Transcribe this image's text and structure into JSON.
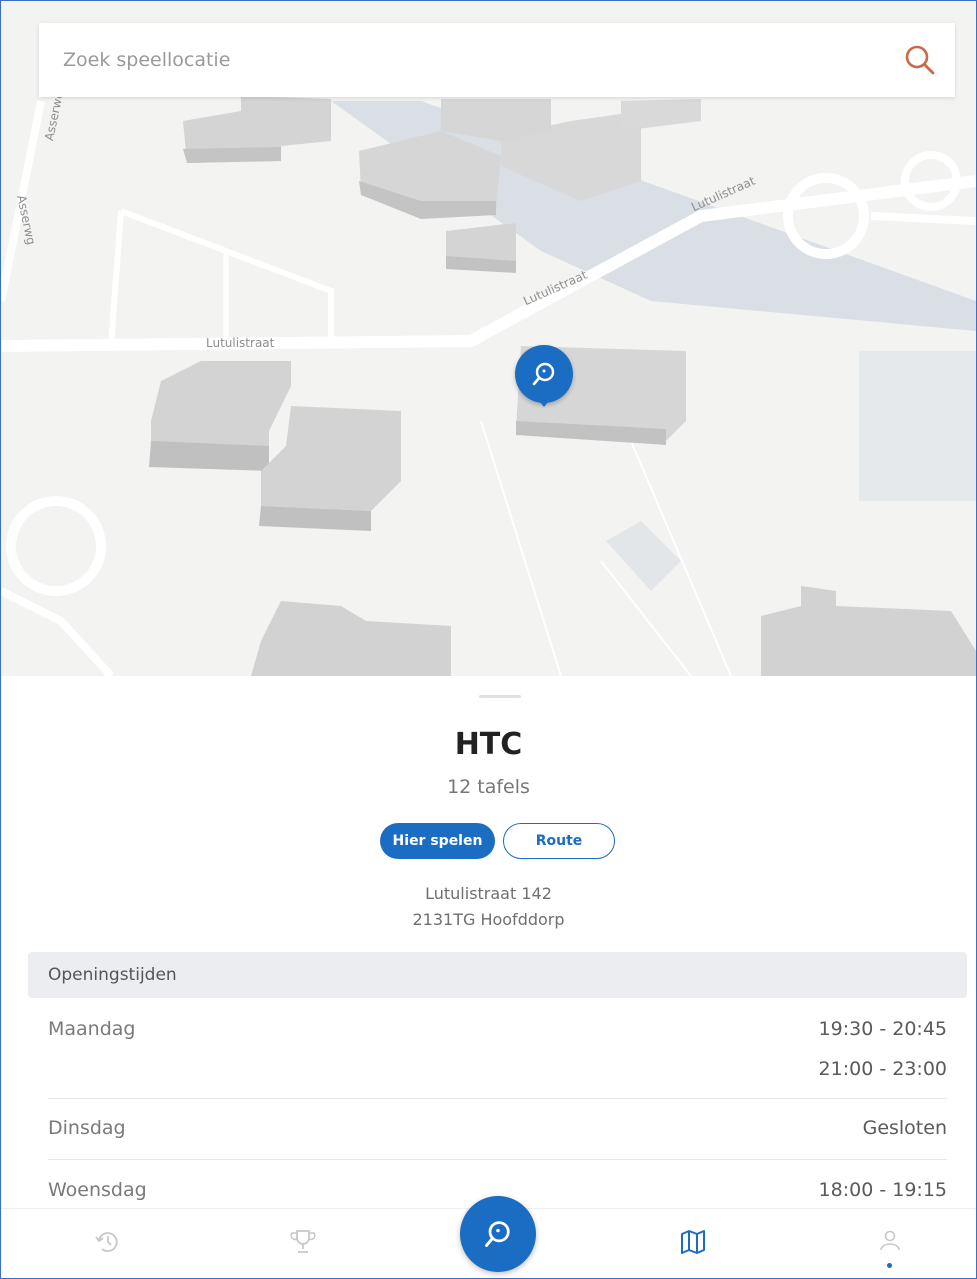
{
  "search": {
    "placeholder": "Zoek speellocatie"
  },
  "map": {
    "street_labels": [
      "Lutulistraat",
      "Lutulistraat",
      "Lutulistraat",
      "Asserwe",
      "Asserwg"
    ]
  },
  "venue": {
    "name": "HTC",
    "tables": "12 tafels",
    "play_button": "Hier spelen",
    "route_button": "Route",
    "address_line1": "Lutulistraat 142",
    "address_line2": "2131TG Hoofddorp"
  },
  "hours": {
    "title": "Openingstijden",
    "days": [
      {
        "day": "Maandag",
        "times": [
          "19:30 - 20:45",
          "21:00 - 23:00"
        ]
      },
      {
        "day": "Dinsdag",
        "times": [
          "Gesloten"
        ]
      },
      {
        "day": "Woensdag",
        "times": [
          "18:00 - 19:15"
        ]
      }
    ]
  },
  "nav": {
    "items": [
      "history-icon",
      "trophy-icon",
      "play-icon",
      "map-icon",
      "profile-icon"
    ],
    "active": "map-icon"
  },
  "colors": {
    "accent": "#1a6dc2",
    "search_icon": "#c96a45"
  }
}
